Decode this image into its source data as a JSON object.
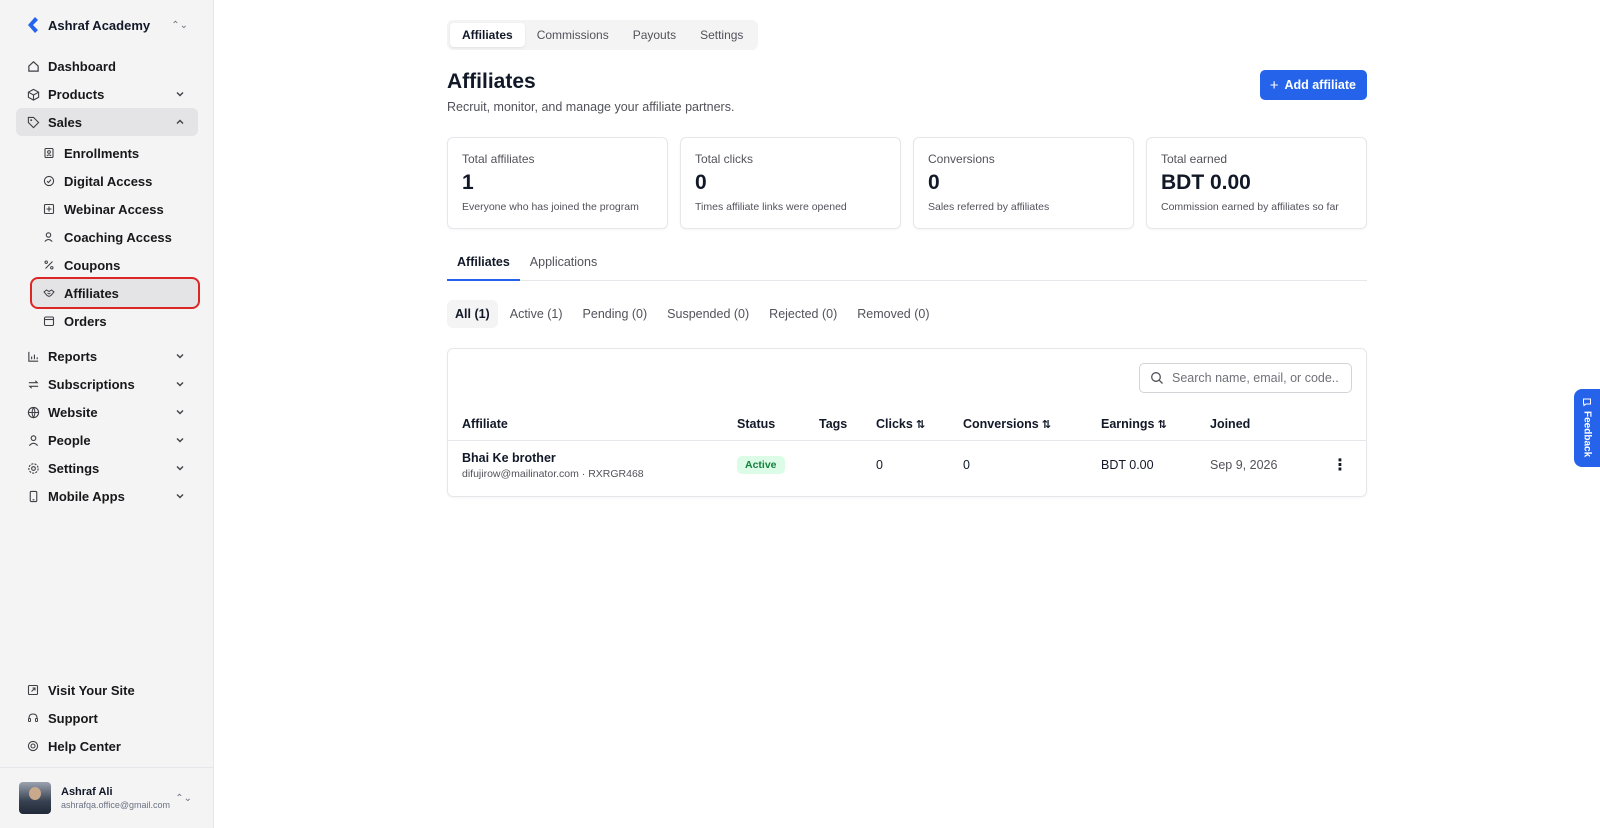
{
  "brand": {
    "name": "Ashraf Academy"
  },
  "sidebar": {
    "items": [
      {
        "label": "Dashboard",
        "icon": "home-icon"
      },
      {
        "label": "Products",
        "icon": "box-icon"
      },
      {
        "label": "Sales",
        "icon": "tag-icon"
      }
    ],
    "sales_children": [
      {
        "label": "Enrollments",
        "icon": "enrollment-icon"
      },
      {
        "label": "Digital Access",
        "icon": "check-circle-icon"
      },
      {
        "label": "Webinar Access",
        "icon": "webinar-icon"
      },
      {
        "label": "Coaching Access",
        "icon": "user-icon"
      },
      {
        "label": "Coupons",
        "icon": "percent-icon"
      },
      {
        "label": "Affiliates",
        "icon": "handshake-icon"
      },
      {
        "label": "Orders",
        "icon": "orders-icon"
      }
    ],
    "more_items": [
      {
        "label": "Reports",
        "icon": "chart-icon"
      },
      {
        "label": "Subscriptions",
        "icon": "repeat-icon"
      },
      {
        "label": "Website",
        "icon": "globe-icon"
      },
      {
        "label": "People",
        "icon": "person-icon"
      },
      {
        "label": "Settings",
        "icon": "gear-icon"
      },
      {
        "label": "Mobile Apps",
        "icon": "mobile-icon"
      }
    ],
    "bottom_items": [
      {
        "label": "Visit Your Site",
        "icon": "external-link-icon"
      },
      {
        "label": "Support",
        "icon": "headset-icon"
      },
      {
        "label": "Help Center",
        "icon": "lifebuoy-icon"
      }
    ]
  },
  "user": {
    "name": "Ashraf Ali",
    "email": "ashrafqa.office@gmail.com"
  },
  "top_tabs": [
    "Affiliates",
    "Commissions",
    "Payouts",
    "Settings"
  ],
  "page": {
    "title": "Affiliates",
    "subtitle": "Recruit, monitor, and manage your affiliate partners.",
    "add_button": "Add affiliate"
  },
  "stats": [
    {
      "label": "Total affiliates",
      "value": "1",
      "desc": "Everyone who has joined the program"
    },
    {
      "label": "Total clicks",
      "value": "0",
      "desc": "Times affiliate links were opened"
    },
    {
      "label": "Conversions",
      "value": "0",
      "desc": "Sales referred by affiliates"
    },
    {
      "label": "Total earned",
      "value": "BDT 0.00",
      "desc": "Commission earned by affiliates so far"
    }
  ],
  "sub_tabs": [
    "Affiliates",
    "Applications"
  ],
  "filters": [
    "All (1)",
    "Active (1)",
    "Pending (0)",
    "Suspended (0)",
    "Rejected (0)",
    "Removed (0)"
  ],
  "search": {
    "placeholder": "Search name, email, or code.."
  },
  "table": {
    "headers": {
      "affiliate": "Affiliate",
      "status": "Status",
      "tags": "Tags",
      "clicks": "Clicks",
      "conversions": "Conversions",
      "earnings": "Earnings",
      "joined": "Joined"
    },
    "sort_glyph": "⇅",
    "rows": [
      {
        "name": "Bhai Ke brother",
        "meta": "difujirow@mailinator.com · RXRGR468",
        "status": "Active",
        "tags": "",
        "clicks": "0",
        "conversions": "0",
        "earnings": "BDT 0.00",
        "joined": "Sep 9, 2026"
      }
    ]
  },
  "feedback": {
    "label": "Feedback"
  },
  "colors": {
    "accent": "#2563eb",
    "highlight": "#dc2626",
    "success_bg": "#dcfce7",
    "success_text": "#15803d"
  }
}
